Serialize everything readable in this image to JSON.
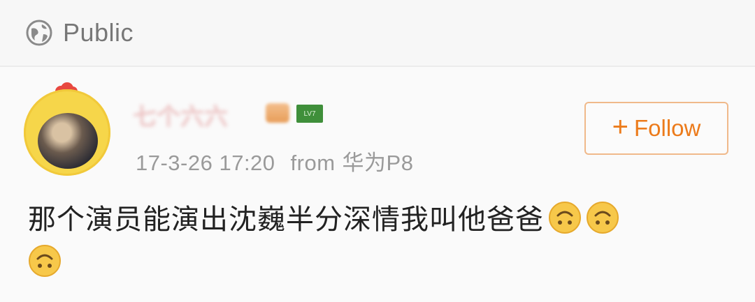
{
  "header": {
    "visibility_label": "Public",
    "visibility_icon": "globe-icon"
  },
  "post": {
    "username_display": "七个六六",
    "level_badge_text": "LV7",
    "timestamp": "17-3-26 17:20",
    "source_prefix": "from",
    "source_device": "华为P8",
    "follow_label": "Follow",
    "follow_icon": "plus-icon",
    "text": "那个演员能演出沈巍半分深情我叫他爸爸",
    "emoji_icon": "upside-down-face-emoji-icon",
    "emoji_count": 3
  },
  "colors": {
    "accent": "#ec7b1b",
    "follow_border": "#f0b98a",
    "meta_text": "#9a9a9a",
    "avatar_yellow": "#f6d64a"
  }
}
